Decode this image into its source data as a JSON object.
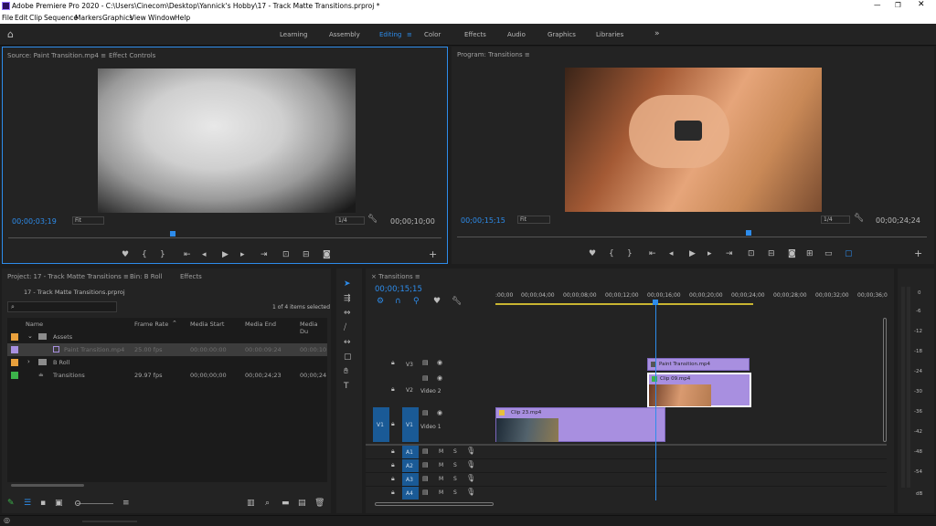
{
  "app": {
    "title": "Adobe Premiere Pro 2020 - C:\\Users\\Cinecom\\Desktop\\Yannick's Hobby\\17 - Track Matte Transitions.prproj *",
    "menu": [
      "File",
      "Edit",
      "Clip",
      "Sequence",
      "Markers",
      "Graphics",
      "View",
      "Window",
      "Help"
    ]
  },
  "workspaces": [
    {
      "label": "Learning"
    },
    {
      "label": "Assembly"
    },
    {
      "label": "Editing",
      "active": true
    },
    {
      "label": "Color"
    },
    {
      "label": "Effects"
    },
    {
      "label": "Audio"
    },
    {
      "label": "Graphics"
    },
    {
      "label": "Libraries"
    }
  ],
  "source": {
    "tab": "Source: Paint Transition.mp4",
    "tab2": "Effect Controls",
    "timecode": "00;00;03;19",
    "fit": "Fit",
    "res": "1/4",
    "duration": "00;00;10;00"
  },
  "program": {
    "tab": "Program: Transitions",
    "timecode": "00;00;15;15",
    "fit": "Fit",
    "res": "1/4",
    "duration": "00;00;24;24"
  },
  "project": {
    "tab": "Project: 17 - Track Matte Transitions",
    "tab2": "Bin: B Roll",
    "tab3": "Effects",
    "file": "17 - Track Matte Transitions.prproj",
    "count": "1 of 4 items selected",
    "cols": [
      "Name",
      "Frame Rate",
      "Media Start",
      "Media End",
      "Media Du"
    ],
    "rows": [
      {
        "name": "Assets",
        "color": "#e8a03c",
        "fr": "",
        "ms": "",
        "me": "",
        "md": ""
      },
      {
        "name": "Paint Transition.mp4",
        "color": "#a890e0",
        "fr": "25.00 fps",
        "ms": "00:00:00:00",
        "me": "00:00:09:24",
        "md": "00:00:10"
      },
      {
        "name": "B Roll",
        "color": "#e8a03c",
        "fr": "",
        "ms": "",
        "me": "",
        "md": ""
      },
      {
        "name": "Transitions",
        "color": "#3cb44a",
        "fr": "29.97 fps",
        "ms": "00;00;00;00",
        "me": "00;00;24;23",
        "md": "00;00;24"
      }
    ]
  },
  "timeline": {
    "tab": "Transitions",
    "timecode": "00;00;15;15",
    "ruler": [
      ":00;00",
      "00;00;04;00",
      "00;00;08;00",
      "00;00;12;00",
      "00;00;16;00",
      "00;00;20;00",
      "00;00;24;00",
      "00;00;28;00",
      "00;00;32;00",
      "00;00;36;0"
    ],
    "tracks": {
      "v3": "V3",
      "v2": "V2",
      "v1": "V1",
      "v2name": "Video 2",
      "v1name": "Video 1",
      "v1src": "V1",
      "a": [
        "A1",
        "A2",
        "A3",
        "A4"
      ]
    },
    "clips": {
      "paint": "Paint Transition.mp4",
      "clip09": "Clip 09.mp4",
      "clip23": "Clip 23.mp4"
    }
  },
  "meter": [
    "0",
    "-6",
    "-12",
    "-18",
    "-24",
    "-30",
    "-36",
    "-42",
    "-48",
    "-54",
    "dB"
  ]
}
